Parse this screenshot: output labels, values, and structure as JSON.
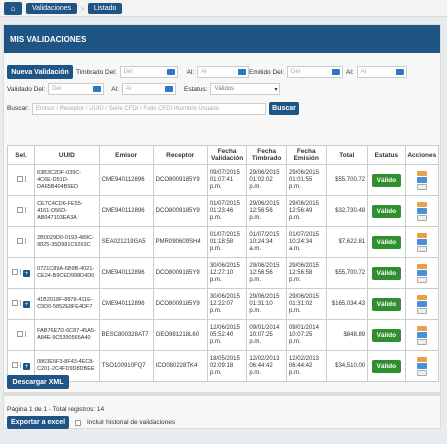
{
  "breadcrumb": {
    "items": [
      "Validaciones",
      "Listado"
    ]
  },
  "panel": {
    "title": "MIS VALIDACIONES"
  },
  "toolbar": {
    "new_label": "Nueva Validación"
  },
  "filters": {
    "timbrado_label": "Timbrado Del:",
    "timbrado_del": "Del",
    "timbrado_al_label": "Al:",
    "timbrado_al": "Al",
    "emitido_label": "Emitido Del:",
    "emitido_del": "Del",
    "emitido_al_label": "Al:",
    "emitido_al": "Al",
    "validado_label": "Validado Del:",
    "validado_del": "Del",
    "validado_al_label": "Al:",
    "validado_al": "Al",
    "estatus_label": "Estatus:",
    "estatus_value": "Válidos",
    "buscar_label": "Buscar:",
    "buscar_placeholder": "Emisor / Receptor / UUID / Serie CFDI / Folio CFDI /Nombre Usuario",
    "buscar_button": "Buscar"
  },
  "table": {
    "headers": [
      "Sel.",
      "UUID",
      "Emisor",
      "Receptor",
      "Fecha Validación",
      "Fecha Timbrado",
      "Fecha Emisión",
      "Total",
      "Estatus",
      "Acciones"
    ],
    "rows": [
      {
        "uuid": "63B3C2DF-039C-4C6E-D51D-DA65B404B5ED",
        "emisor": "CME940112896",
        "receptor": "DCO8009185Y9",
        "validacion": "09/07/2015 01:07:41 p.m.",
        "timbrado": "29/06/2015 01:02:02 p.m.",
        "emision": "29/06/2015 01:01:55 p.m.",
        "total": "$55,700.72",
        "status": "Válido",
        "plus": false
      },
      {
        "uuid": "CE7C4CD6-FE55-4161-D56D-AB047103EA3A",
        "emisor": "CME940112896",
        "receptor": "DCO8009185Y9",
        "validacion": "01/07/2015 01:23:46 p.m.",
        "timbrado": "29/06/2015 12:56:56 p.m.",
        "emision": "29/06/2015 12:56:49 p.m.",
        "total": "$32,730.48",
        "status": "Válido",
        "plus": false
      },
      {
        "uuid": "2B0029D0-0193-489C-9825-35D981C9263C",
        "emisor": "SEA021219GA5",
        "receptor": "PMR090609SH4",
        "validacion": "01/07/2015 01:18:58 p.m.",
        "timbrado": "01/07/2015 10:24:34 a.m.",
        "emision": "01/07/2015 10:24:34 a.m.",
        "total": "$7,622.81",
        "status": "Válido",
        "plus": false
      },
      {
        "uuid": "0721C89A-6B9B-4021-CE24-B9CED998D4D0",
        "emisor": "CME940112896",
        "receptor": "DCO8009185Y9",
        "validacion": "30/06/2015 12:27:10 p.m.",
        "timbrado": "29/06/2015 12:56:56 p.m.",
        "emision": "29/06/2015 12:56:58 p.m.",
        "total": "$55,700.72",
        "status": "Válido",
        "plus": true
      },
      {
        "uuid": "41B2018F-8878-411E-C9D0-5852E8FE4DF7",
        "emisor": "CME940112896",
        "receptor": "DCO8009185Y9",
        "validacion": "30/06/2015 12:22:07 p.m.",
        "timbrado": "29/06/2015 01:31:10 p.m.",
        "emision": "29/06/2015 01:31:02 p.m.",
        "total": "$165,034.43",
        "status": "Válido",
        "plus": true
      },
      {
        "uuid": "FAB76E7D-6C87-45A5-A84E-9C5390566A40",
        "emisor": "BESC800328AT7",
        "receptor": "GEO981218L60",
        "validacion": "12/06/2015 05:52:40 p.m.",
        "timbrado": "09/01/2014 10:07:25 p.m.",
        "emision": "09/01/2014 10:07:25 p.m.",
        "total": "$848.89",
        "status": "Válido",
        "plus": false
      },
      {
        "uuid": "0863E5F3-8F43-4EC8-C201-2C4FD9D8DBEE",
        "emisor": "TSO100910FQ7",
        "receptor": "ICO080228TK4",
        "validacion": "18/05/2015 02:09:18 p.m.",
        "timbrado": "12/02/2013 06:44:42 p.m.",
        "emision": "12/02/2013 06:44:42 p.m.",
        "total": "$34,510.00",
        "status": "Válido",
        "plus": true
      }
    ]
  },
  "footer": {
    "download_xml": "Descargar XML",
    "pagination": "Página 1 de 1 - Total registros: 14",
    "export_excel": "Exportar a excel",
    "history_label": "Incluir historial de validaciones"
  },
  "colors": {
    "primary": "#1f5585",
    "status": "#2f8f2f"
  }
}
